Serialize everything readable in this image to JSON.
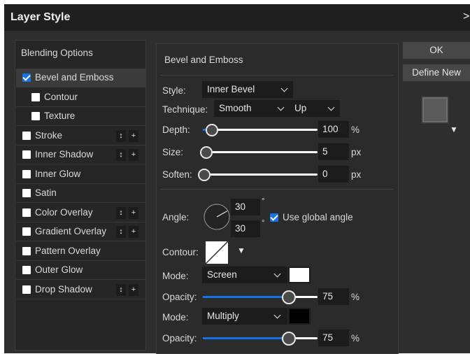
{
  "window": {
    "title": "Layer Style",
    "close_glyph": ">"
  },
  "sidebar": {
    "header": "Blending Options",
    "items": [
      {
        "label": "Bevel and Emboss",
        "checked": true,
        "indent": false,
        "selected": true,
        "controls": false
      },
      {
        "label": "Contour",
        "checked": false,
        "indent": true,
        "selected": false,
        "controls": false
      },
      {
        "label": "Texture",
        "checked": false,
        "indent": true,
        "selected": false,
        "controls": false
      },
      {
        "label": "Stroke",
        "checked": false,
        "indent": false,
        "selected": false,
        "controls": true
      },
      {
        "label": "Inner Shadow",
        "checked": false,
        "indent": false,
        "selected": false,
        "controls": true
      },
      {
        "label": "Inner Glow",
        "checked": false,
        "indent": false,
        "selected": false,
        "controls": false
      },
      {
        "label": "Satin",
        "checked": false,
        "indent": false,
        "selected": false,
        "controls": false
      },
      {
        "label": "Color Overlay",
        "checked": false,
        "indent": false,
        "selected": false,
        "controls": true
      },
      {
        "label": "Gradient Overlay",
        "checked": false,
        "indent": false,
        "selected": false,
        "controls": true
      },
      {
        "label": "Pattern Overlay",
        "checked": false,
        "indent": false,
        "selected": false,
        "controls": false
      },
      {
        "label": "Outer Glow",
        "checked": false,
        "indent": false,
        "selected": false,
        "controls": false
      },
      {
        "label": "Drop Shadow",
        "checked": false,
        "indent": false,
        "selected": false,
        "controls": true
      }
    ],
    "reorder_glyph": "↕",
    "add_glyph": "+"
  },
  "bevel": {
    "section_title": "Bevel and Emboss",
    "style_label": "Style:",
    "style_value": "Inner Bevel",
    "technique_label": "Technique:",
    "technique_value": "Smooth",
    "direction_value": "Up",
    "depth_label": "Depth:",
    "depth_value": "100",
    "depth_unit": "%",
    "depth_fraction": 0.08,
    "size_label": "Size:",
    "size_value": "5",
    "size_unit": "px",
    "size_fraction": 0.03,
    "soften_label": "Soften:",
    "soften_value": "0",
    "soften_unit": "px",
    "soften_fraction": 0.0,
    "angle_label": "Angle:",
    "angle_value": "30",
    "altitude_value": "30",
    "degree_symbol": "°",
    "global_angle_label": "Use global angle",
    "global_angle_checked": true,
    "contour_label": "Contour:",
    "highlight_mode_label": "Mode:",
    "highlight_mode_value": "Screen",
    "highlight_color": "#ffffff",
    "highlight_opacity_label": "Opacity:",
    "highlight_opacity_value": "75",
    "highlight_opacity_unit": "%",
    "highlight_opacity_fraction": 0.75,
    "shadow_mode_label": "Mode:",
    "shadow_mode_value": "Multiply",
    "shadow_color": "#000000",
    "shadow_opacity_label": "Opacity:",
    "shadow_opacity_value": "75",
    "shadow_opacity_unit": "%",
    "shadow_opacity_fraction": 0.75
  },
  "actions": {
    "ok_label": "OK",
    "define_new_label": "Define New",
    "dropdown_glyph": "▼"
  },
  "colors": {
    "accent": "#1473e6",
    "panel": "#2b2b2b",
    "title_bar": "#1f1f1f"
  }
}
